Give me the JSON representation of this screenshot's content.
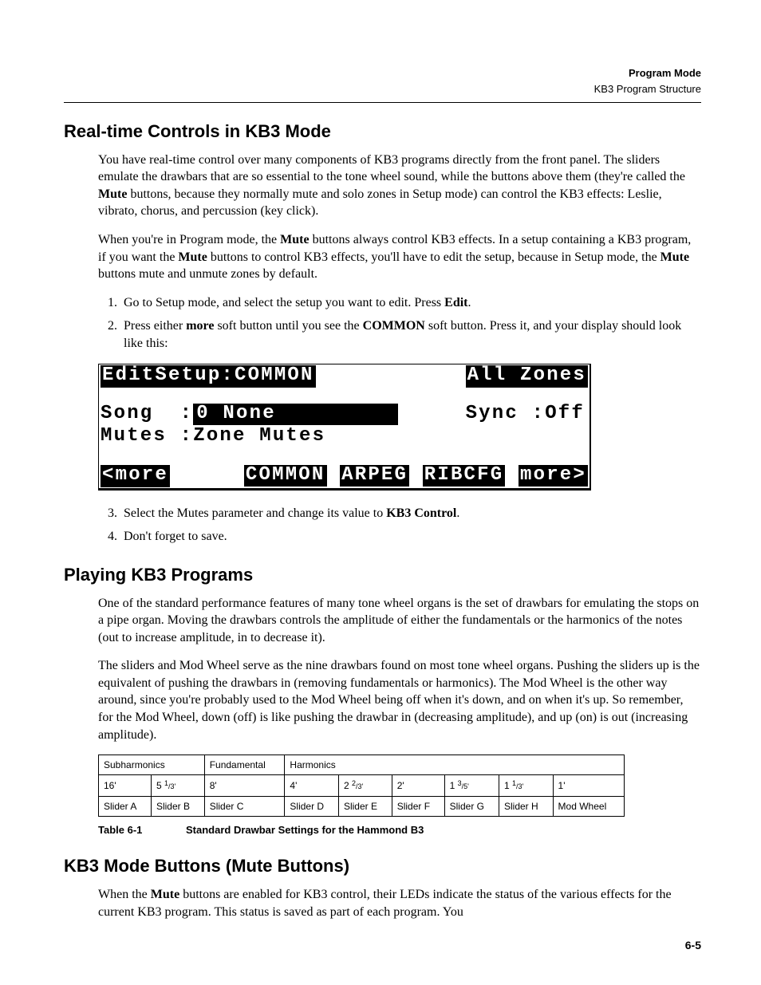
{
  "header": {
    "title": "Program Mode",
    "subtitle": "KB3 Program Structure"
  },
  "section1": {
    "title": "Real-time Controls in KB3 Mode",
    "p1a": "You have real-time control over many components of KB3 programs directly from the front panel. The sliders emulate the drawbars that are so essential to the tone wheel sound, while the buttons above them (they're called the ",
    "p1b_bold": "Mute",
    "p1c": " buttons, because they normally mute and solo zones in Setup mode) can control the KB3 effects: Leslie, vibrato, chorus, and percussion (key click).",
    "p2a": "When you're in Program mode, the ",
    "p2b_bold": "Mute",
    "p2c": " buttons always control KB3 effects. In a setup containing a KB3 program, if you want the ",
    "p2d_bold": "Mute",
    "p2e": " buttons to control KB3 effects, you'll have to edit the setup, because in Setup mode, the ",
    "p2f_bold": "Mute",
    "p2g": " buttons mute and unmute zones by default.",
    "step1a": "Go to Setup mode, and select the setup you want to edit. Press ",
    "step1b_bold": "Edit",
    "step1c": ".",
    "step2a": "Press either ",
    "step2b_bold": "more",
    "step2c": " soft button until you see the ",
    "step2d_bold": "COMMON",
    "step2e": " soft button. Press it, and your display should look like this:",
    "step3a": "Select the Mutes parameter and change its value to ",
    "step3b_bold": "KB3 Control",
    "step3c": ".",
    "step4": "Don't forget to save."
  },
  "lcd": {
    "title_left": "EditSetup:COMMON",
    "title_right": "All Zones",
    "song_label": "Song  :",
    "song_value": "0 None         ",
    "sync_label": "Sync :",
    "sync_value": "Off",
    "mutes_label": "Mutes :",
    "mutes_value": "Zone Mutes",
    "soft_more_left": "<more",
    "soft_common": "COMMON",
    "soft_arpeg": "ARPEG",
    "soft_ribcfg": "RIBCFG",
    "soft_more_right": "more>"
  },
  "section2": {
    "title": "Playing KB3 Programs",
    "p1": "One of the standard performance features of many tone wheel organs is the set of drawbars for emulating the stops on a pipe organ. Moving the drawbars controls the amplitude of either the fundamentals or the harmonics of the notes (out to increase amplitude, in to decrease it).",
    "p2": "The sliders and Mod Wheel serve as the nine drawbars found on most tone wheel organs. Pushing the sliders up is the equivalent of pushing the drawbars in (removing fundamentals or harmonics). The Mod Wheel is the other way around, since you're probably used to the Mod Wheel being off when it's down, and on when it's up. So remember, for the Mod Wheel, down (off) is like pushing the drawbar in (decreasing amplitude), and up (on) is out (increasing amplitude)."
  },
  "table": {
    "group_headers": [
      "Subharmonics",
      "Fundamental",
      "Harmonics"
    ],
    "row_feet": {
      "c0": "16'",
      "c1_a": "5 ",
      "c1_sup": "1",
      "c1_frac": "/3'",
      "c2": "8'",
      "c3": "4'",
      "c4_a": "2 ",
      "c4_sup": "2",
      "c4_frac": "/3'",
      "c5": "2'",
      "c6_a": "1 ",
      "c6_sup": "3",
      "c6_frac": "/5'",
      "c7_a": "1 ",
      "c7_sup": "1",
      "c7_frac": "/3'",
      "c8": "1'"
    },
    "row_sliders": [
      "Slider A",
      "Slider B",
      "Slider C",
      "Slider D",
      "Slider E",
      "Slider F",
      "Slider G",
      "Slider H",
      "Mod Wheel"
    ],
    "caption_label": "Table 6-1",
    "caption_text": "Standard Drawbar Settings for the Hammond B3"
  },
  "section3": {
    "title": "KB3 Mode Buttons (Mute Buttons)",
    "p1a": "When the ",
    "p1b_bold": "Mute",
    "p1c": " buttons are enabled for KB3 control, their LEDs indicate the status of the various effects for the current KB3 program. This status is saved as part of each program. You"
  },
  "page_number": "6-5"
}
